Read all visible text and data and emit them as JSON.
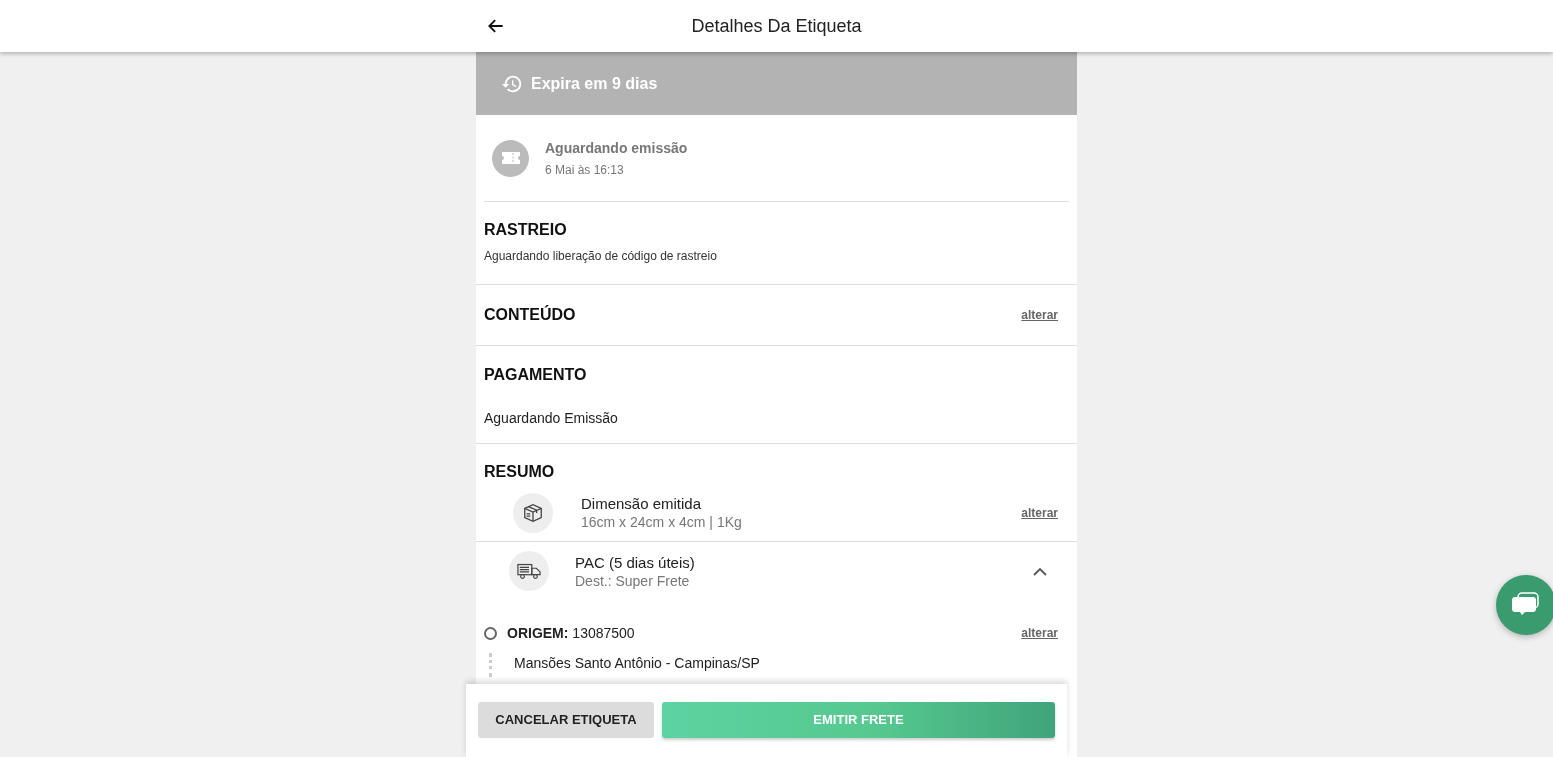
{
  "header": {
    "title": "Detalhes Da Etiqueta"
  },
  "expiry": {
    "text": "Expira em 9 dias"
  },
  "status": {
    "title": "Aguardando emissão",
    "date": "6 Mai às 16:13"
  },
  "sections": [
    {
      "kind": "note",
      "title": "RASTREIO",
      "text": "Aguardando liberação de código de rastreio"
    },
    {
      "kind": "link",
      "title": "CONTEÚDO",
      "link": "alterar"
    },
    {
      "kind": "value",
      "title": "PAGAMENTO",
      "text": "Aguardando Emissão"
    }
  ],
  "summary": {
    "title": "RESUMO",
    "items": [
      {
        "kind": "package",
        "title": "Dimensão emitida",
        "detail": "16cm x 24cm x 4cm | 1Kg",
        "link": "alterar"
      },
      {
        "kind": "shipping",
        "title": "PAC (5 dias úteis)",
        "detail": "Dest.: Super Frete",
        "expanded": true
      }
    ],
    "origin": {
      "label": "ORIGEM:",
      "value": "13087500",
      "link": "alterar",
      "address": "Mansões Santo Antônio - Campinas/SP"
    }
  },
  "footer": {
    "buttons": [
      {
        "kind": "secondary",
        "label": "CANCELAR ETIQUETA"
      },
      {
        "kind": "primary",
        "label": "EMITIR FRETE"
      }
    ]
  }
}
